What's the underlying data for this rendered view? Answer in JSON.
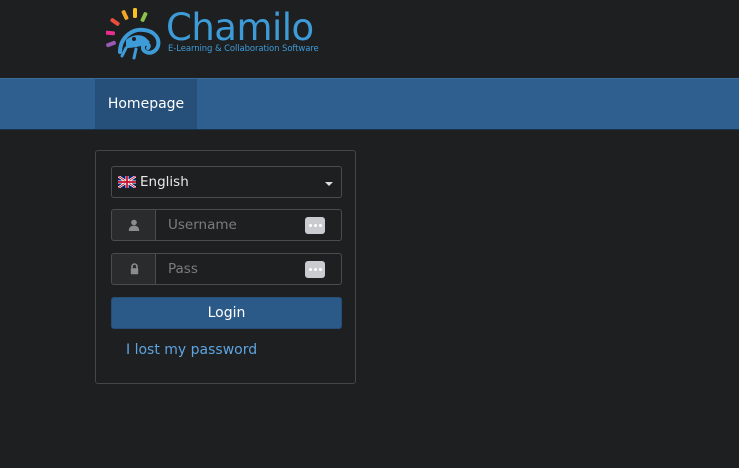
{
  "header": {
    "logo_name": "Chamilo",
    "logo_tagline": "E-Learning & Collaboration Software"
  },
  "nav": {
    "items": [
      {
        "label": "Homepage"
      }
    ]
  },
  "login": {
    "language": {
      "selected": "English",
      "flag_icon": "uk-flag-icon"
    },
    "username": {
      "placeholder": "Username",
      "value": "",
      "icon": "user-icon"
    },
    "password": {
      "placeholder": "Pass",
      "value": "",
      "icon": "lock-icon"
    },
    "login_label": "Login",
    "lost_password_label": "I lost my password"
  },
  "colors": {
    "background": "#1e1f21",
    "navbar": "#2f5f8e",
    "nav_active": "#26507a",
    "button": "#2c5a88",
    "link": "#5ea4e0",
    "logo_blue": "#3d9bd8"
  }
}
